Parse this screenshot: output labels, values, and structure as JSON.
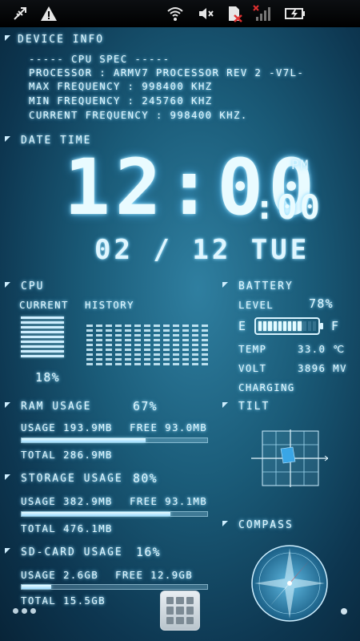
{
  "status_bar": {
    "icons": [
      "usb-icon",
      "warning-icon",
      "wifi-icon",
      "mute-icon",
      "no-sim-icon",
      "no-signal-icon",
      "battery-charging-icon"
    ]
  },
  "device_info": {
    "title": "DEVICE INFO",
    "cpu_spec_header": "-----   CPU SPEC   -----",
    "processor": "PROCESSOR : ARMV7 PROCESSOR REV 2 -V7L-",
    "max_freq": "MAX FREQUENCY : 998400 KHZ",
    "min_freq": "MIN FREQUENCY : 245760 KHZ",
    "current_freq": "CURRENT FREQUENCY : 998400 KHZ."
  },
  "date_time": {
    "title": "DATE TIME",
    "time": "12:00",
    "seconds": ":00",
    "ampm": "PM",
    "date": "02 / 12  TUE"
  },
  "cpu": {
    "title": "CPU",
    "current_label": "CURRENT",
    "history_label": "HISTORY",
    "percent": "18%"
  },
  "battery": {
    "title": "BATTERY",
    "level_label": "LEVEL",
    "level_value": "78%",
    "level_fraction": 0.78,
    "empty_label": "E",
    "full_label": "F",
    "temp_label": "TEMP",
    "temp_value": "33.0 ℃",
    "volt_label": "VOLT",
    "volt_value": "3896 MV",
    "status": "CHARGING"
  },
  "ram": {
    "title": "RAM USAGE",
    "percent": "67%",
    "fraction": 0.67,
    "usage": "USAGE 193.9MB",
    "free": "FREE 93.0MB",
    "total": "TOTAL 286.9MB"
  },
  "storage": {
    "title": "STORAGE USAGE",
    "percent": "80%",
    "fraction": 0.8,
    "usage": "USAGE 382.9MB",
    "free": "FREE 93.1MB",
    "total": "TOTAL 476.1MB"
  },
  "sdcard": {
    "title": "SD-CARD USAGE",
    "percent": "16%",
    "fraction": 0.16,
    "usage": "USAGE 2.6GB",
    "free": "FREE 12.9GB",
    "total": "TOTAL 15.5GB"
  },
  "tilt": {
    "title": "TILT"
  },
  "compass": {
    "title": "COMPASS"
  },
  "colors": {
    "accent": "#dff6ff",
    "bar_fill": "#bfeaff",
    "background": "#1a5b78"
  }
}
